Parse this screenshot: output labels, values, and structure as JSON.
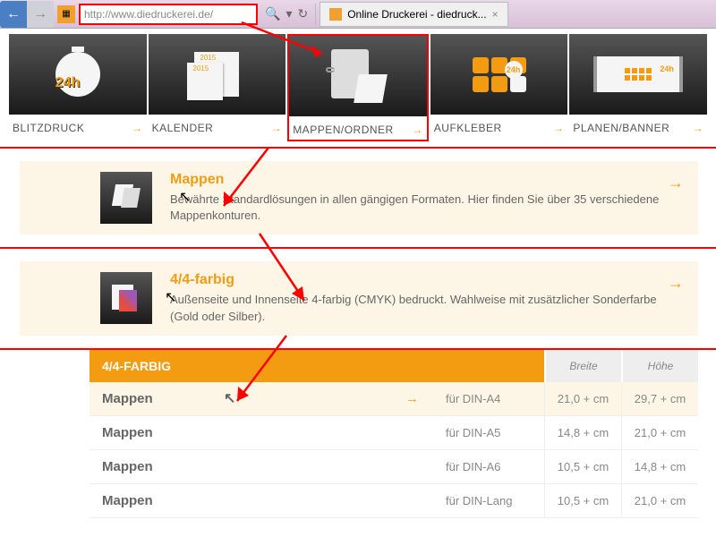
{
  "browser": {
    "url": "http://www.diedruckerei.de/",
    "tab_title": "Online Druckerei - diedruck..."
  },
  "categories": [
    {
      "label": "BLITZDRUCK",
      "icon": "clock-24h",
      "highlighted": false
    },
    {
      "label": "KALENDER",
      "icon": "calendar",
      "highlighted": false
    },
    {
      "label": "MAPPEN/ORDNER",
      "icon": "folder",
      "highlighted": true
    },
    {
      "label": "AUFKLEBER",
      "icon": "stickers",
      "highlighted": false
    },
    {
      "label": "PLANEN/BANNER",
      "icon": "banner",
      "highlighted": false
    }
  ],
  "options": [
    {
      "title": "Mappen",
      "desc": "Bewährte Standardlösungen in allen gängigen Formaten. Hier finden Sie über 35 verschiedene Mappenkonturen.",
      "thumb": "mappen"
    },
    {
      "title": "4/4-farbig",
      "desc": "Außenseite und Innenseite 4-farbig (CMYK) bedruckt. Wahlweise mit zusätzlicher Sonderfarbe (Gold oder Silber).",
      "thumb": "farbig"
    }
  ],
  "table": {
    "title": "4/4-FARBIG",
    "col_breite": "Breite",
    "col_hoehe": "Höhe",
    "rows": [
      {
        "name": "Mappen",
        "format": "für DIN-A4",
        "breite": "21,0 + cm",
        "hoehe": "29,7 + cm",
        "hl": true
      },
      {
        "name": "Mappen",
        "format": "für DIN-A5",
        "breite": "14,8 + cm",
        "hoehe": "21,0 + cm",
        "hl": false
      },
      {
        "name": "Mappen",
        "format": "für DIN-A6",
        "breite": "10,5 + cm",
        "hoehe": "14,8 + cm",
        "hl": false
      },
      {
        "name": "Mappen",
        "format": "für DIN-Lang",
        "breite": "10,5 + cm",
        "hoehe": "21,0 + cm",
        "hl": false
      }
    ]
  },
  "arrow_glyph": "→"
}
